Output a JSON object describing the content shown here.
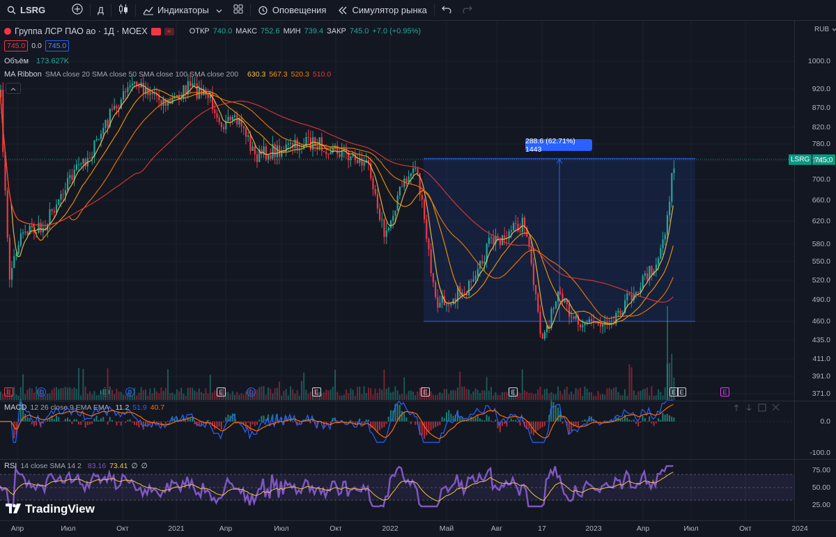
{
  "toolbar": {
    "symbol": "LSRG",
    "interval": "Д",
    "indicators_label": "Индикаторы",
    "alerts_label": "Оповещения",
    "replay_label": "Симулятор рынка"
  },
  "legend": {
    "title": "Группа ЛСР ПАО ао · 1Д · MOEX",
    "open_label": "ОТКР",
    "open": "740.0",
    "high_label": "МАКС",
    "high": "752.6",
    "low_label": "МИН",
    "low": "739.4",
    "close_label": "ЗАКР",
    "close": "745.0",
    "change": "+7.0 (+0.95%)",
    "bid": "745.0",
    "spread": "0.0",
    "ask": "745.0",
    "volume_label": "Объём",
    "volume": "173.627K",
    "ma_label": "MA Ribbon",
    "ma_params": "SMA close 20 SMA close 50 SMA close 100 SMA close 200",
    "ma_values": [
      "630.3",
      "567.3",
      "520.3",
      "510.0"
    ],
    "ma_colors": [
      "#f7c548",
      "#ff9800",
      "#f57c00",
      "#e53935"
    ]
  },
  "currency": "RUB",
  "price_axis": [
    "1000.0",
    "920.0",
    "870.0",
    "820.0",
    "780.0",
    "740.0",
    "700.0",
    "660.0",
    "620.0",
    "580.0",
    "550.0",
    "520.0",
    "490.0",
    "460.0",
    "435.0",
    "411.0",
    "391.0",
    "371.0"
  ],
  "last_price": {
    "symbol": "LSRG",
    "value": "745.0"
  },
  "measure_label": "288.6 (62.71%) 1443",
  "events": [
    {
      "type": "r",
      "label": "E"
    },
    {
      "type": "d",
      "label": "D"
    },
    {
      "type": "s",
      "label": "E"
    },
    {
      "type": "d",
      "label": "D"
    },
    {
      "type": "e",
      "label": "E"
    },
    {
      "type": "d",
      "label": "D"
    },
    {
      "type": "e",
      "label": "E"
    },
    {
      "type": "e",
      "label": "E"
    },
    {
      "type": "e",
      "label": "E"
    },
    {
      "type": "e",
      "label": "E"
    },
    {
      "type": "e",
      "label": "E"
    },
    {
      "type": "m",
      "label": "E"
    }
  ],
  "macd": {
    "label": "MACD",
    "params": "12 26 close 9 EMA EMA",
    "values": [
      "11.2",
      "51.9",
      "40.7"
    ],
    "axis": [
      "0.0",
      "-100.0"
    ]
  },
  "rsi": {
    "label": "RSI",
    "params": "14 close SMA 14 2",
    "values": [
      "83.16",
      "73.41",
      "∅",
      "∅"
    ],
    "axis": [
      "75.00",
      "50.00",
      "25.00"
    ]
  },
  "x_axis": [
    "Апр",
    "Июл",
    "Окт",
    "2021",
    "Апр",
    "Июл",
    "Окт",
    "2022",
    "Май",
    "Авг",
    "17",
    "2023",
    "Апр",
    "Июл",
    "Окт",
    "2024"
  ],
  "brand": "TradingView",
  "colors": {
    "up": "#26a69a",
    "down": "#f23645",
    "accent": "#2962ff",
    "rsi": "#7e57c2"
  }
}
